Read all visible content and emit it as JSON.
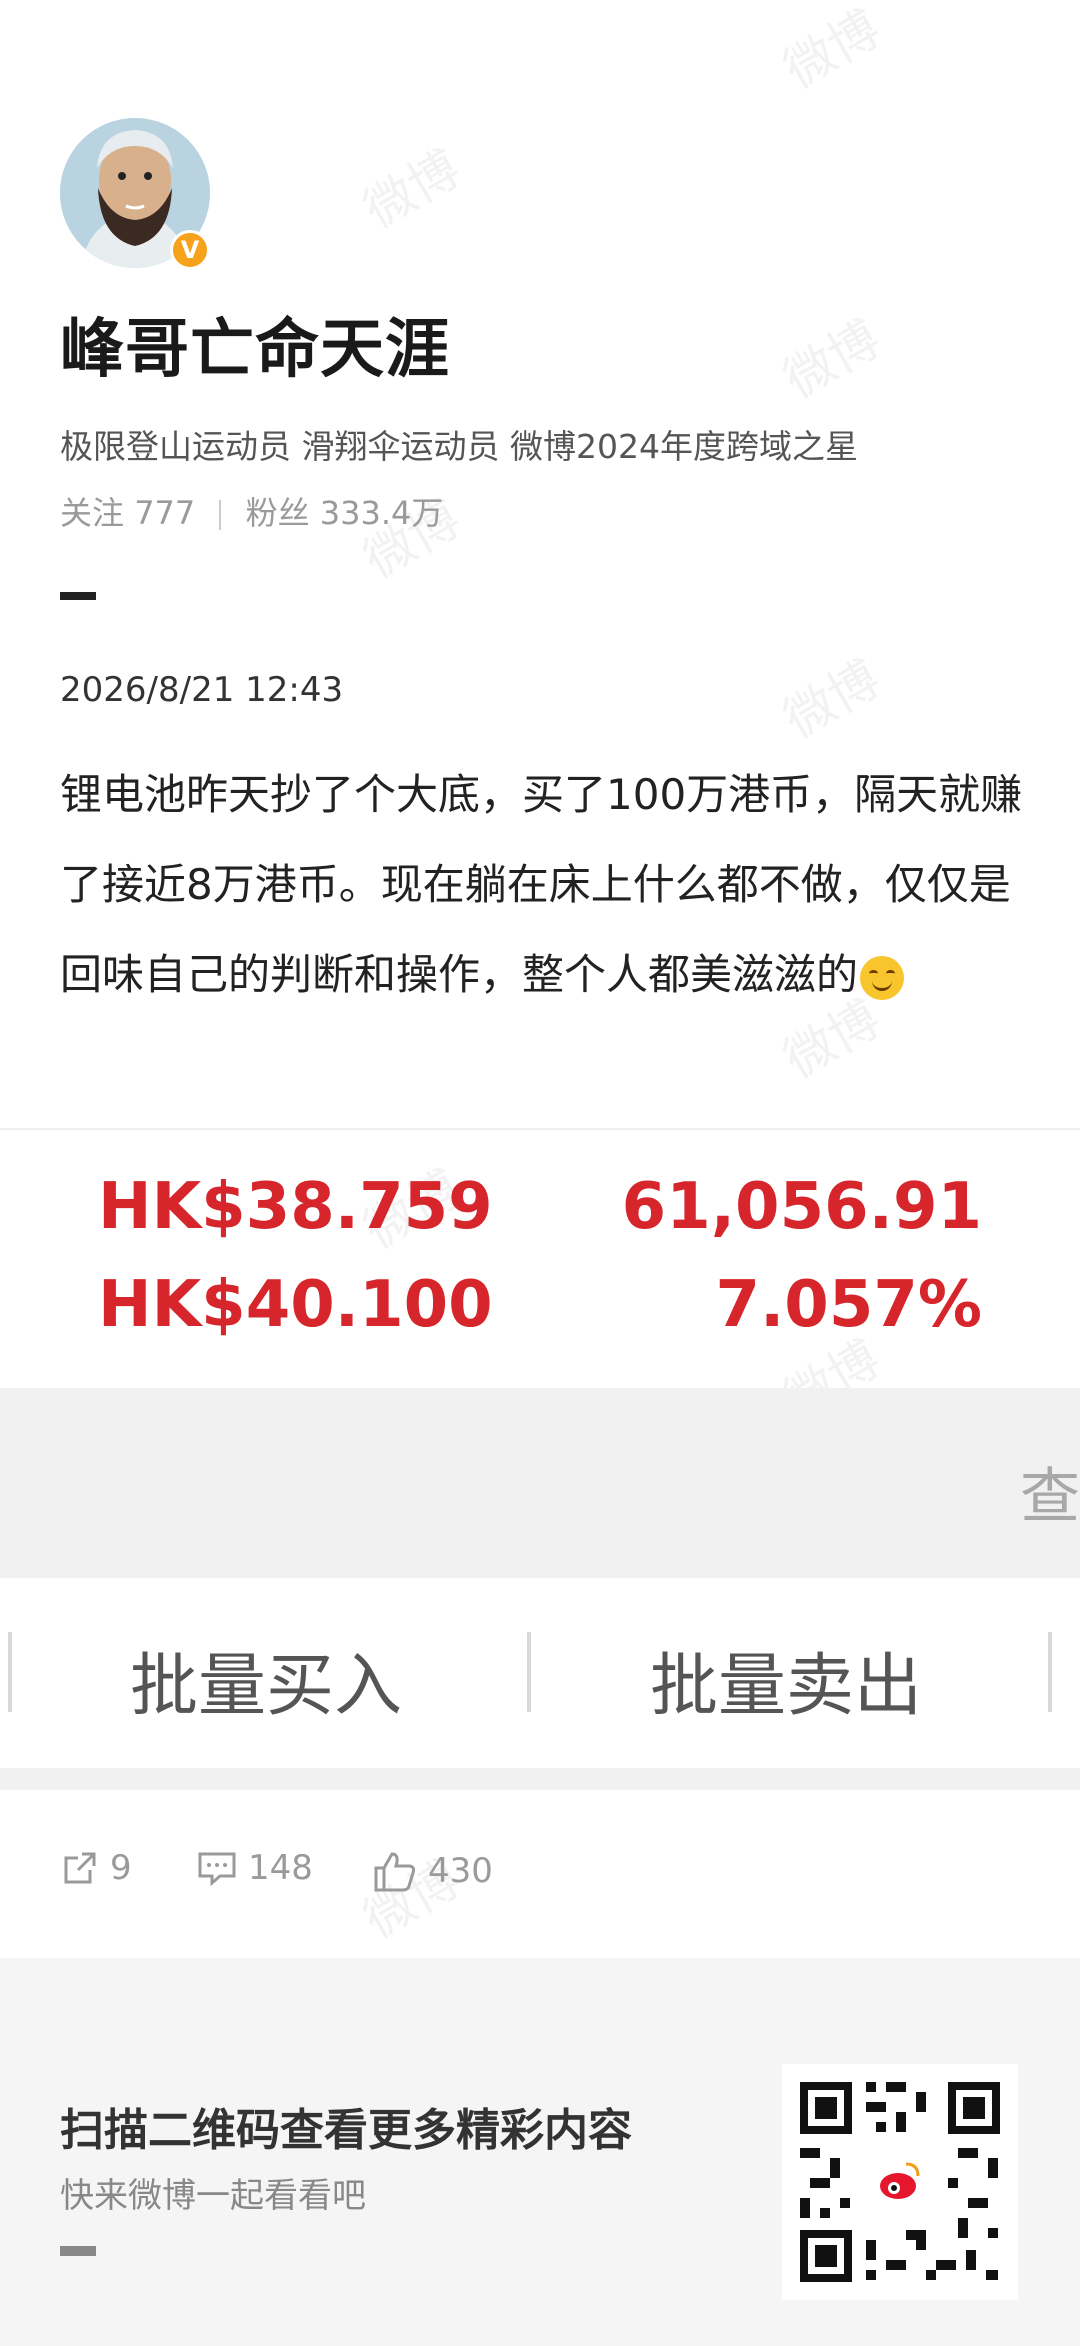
{
  "profile": {
    "name": "峰哥亡命天涯",
    "verified_badge": "V",
    "bio": "极限登山运动员 滑翔伞运动员 微博2024年度跨域之星",
    "following_label": "关注",
    "following_count": "777",
    "followers_label": "粉丝",
    "followers_count": "333.4万"
  },
  "post": {
    "timestamp": "2026/8/21 12:43",
    "text": "锂电池昨天抄了个大底，买了100万港币，隔天就赚了接近8万港币。现在躺在床上什么都不做，仅仅是回味自己的判断和操作，整个人都美滋滋的",
    "emoji": "smiling-face-icon"
  },
  "stock": {
    "cost_price": "HK$38.759",
    "current_price": "HK$40.100",
    "profit": "61,056.91",
    "profit_pct": "7.057%",
    "color": "#d6262b",
    "view_label": "查看"
  },
  "trade": {
    "batch_buy": "批量买入",
    "batch_sell": "批量卖出"
  },
  "actions": {
    "reposts": "9",
    "comments": "148",
    "likes": "430"
  },
  "footer": {
    "title": "扫描二维码查看更多精彩内容",
    "subtitle": "快来微博一起看看吧"
  },
  "watermark": "微博"
}
